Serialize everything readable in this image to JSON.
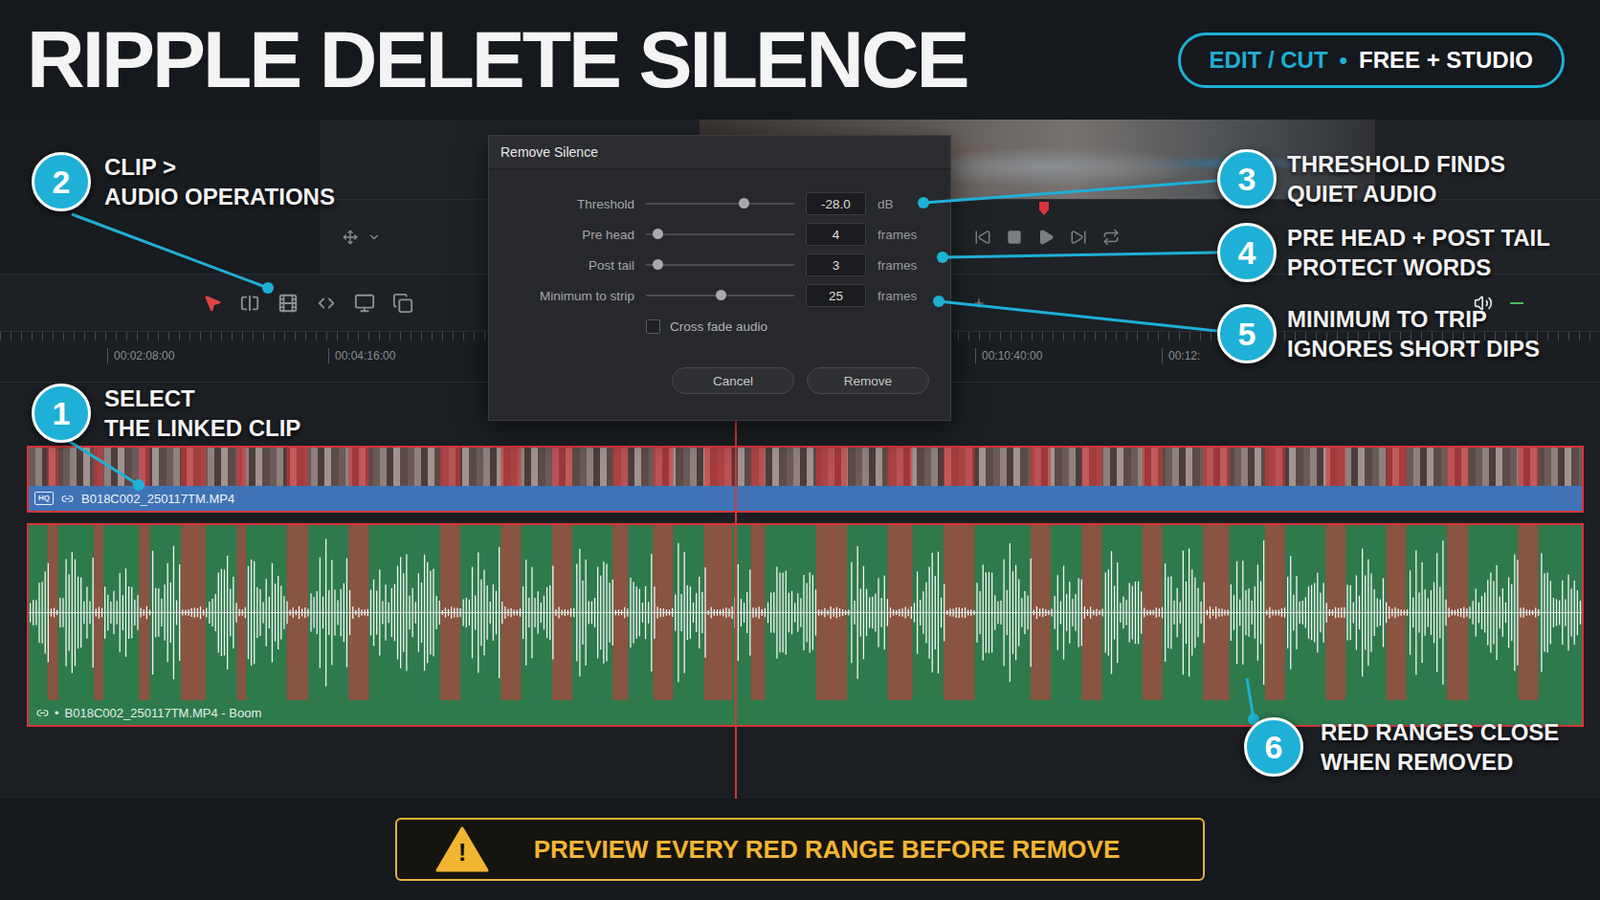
{
  "title": "RIPPLE DELETE SILENCE",
  "badge": {
    "section": "EDIT / CUT",
    "separator": "•",
    "edition": "FREE + STUDIO"
  },
  "dialog": {
    "title": "Remove Silence",
    "rows": [
      {
        "label": "Threshold",
        "value": "-28.0",
        "unit": "dB",
        "level": 0.655
      },
      {
        "label": "Pre head",
        "value": "4",
        "unit": "frames",
        "level": 0.08
      },
      {
        "label": "Post tail",
        "value": "3",
        "unit": "frames",
        "level": 0.076
      },
      {
        "label": "Minimum to strip",
        "value": "25",
        "unit": "frames",
        "level": 0.5
      }
    ],
    "checkbox": {
      "label": "Cross fade audio",
      "checked": false
    },
    "buttons": [
      "Cancel",
      "Remove"
    ]
  },
  "ruler": {
    "timecodes": [
      "00:02:08:00",
      "00:04:16:00",
      "00:10:40:00",
      "00:12:"
    ]
  },
  "tracks": {
    "video": {
      "badge": "HQ",
      "name": "B018C002_250117TM.MP4",
      "selected": true
    },
    "audio": {
      "marker": "•",
      "name": "B018C002_250117TM.MP4 - Boom",
      "selected": true
    }
  },
  "silence_ranges": [
    [
      0.012,
      0.019
    ],
    [
      0.042,
      0.048
    ],
    [
      0.071,
      0.078
    ],
    [
      0.098,
      0.114
    ],
    [
      0.134,
      0.14
    ],
    [
      0.166,
      0.18
    ],
    [
      0.206,
      0.219
    ],
    [
      0.265,
      0.278
    ],
    [
      0.304,
      0.317
    ],
    [
      0.337,
      0.35
    ],
    [
      0.376,
      0.386
    ],
    [
      0.402,
      0.415
    ],
    [
      0.435,
      0.453
    ],
    [
      0.465,
      0.474
    ],
    [
      0.507,
      0.527
    ],
    [
      0.553,
      0.569
    ],
    [
      0.589,
      0.609
    ],
    [
      0.645,
      0.658
    ],
    [
      0.678,
      0.691
    ],
    [
      0.717,
      0.73
    ],
    [
      0.756,
      0.773
    ],
    [
      0.796,
      0.809
    ],
    [
      0.835,
      0.848
    ],
    [
      0.874,
      0.887
    ],
    [
      0.913,
      0.927
    ],
    [
      0.959,
      0.972
    ]
  ],
  "callouts": [
    {
      "number": "1",
      "lines": [
        "SELECT",
        "THE LINKED CLIP"
      ]
    },
    {
      "number": "2",
      "lines": [
        "CLIP >",
        "AUDIO OPERATIONS"
      ]
    },
    {
      "number": "3",
      "lines": [
        "THRESHOLD FINDS",
        "QUIET AUDIO"
      ]
    },
    {
      "number": "4",
      "lines": [
        "PRE HEAD + POST TAIL",
        "PROTECT WORDS"
      ]
    },
    {
      "number": "5",
      "lines": [
        "MINIMUM TO TRIP",
        "IGNORES SHORT DIPS"
      ]
    },
    {
      "number": "6",
      "lines": [
        "RED RANGES CLOSE",
        "WHEN REMOVED"
      ]
    }
  ],
  "warning": {
    "icon": "!",
    "text": "PREVIEW EVERY RED RANGE BEFORE REMOVE"
  }
}
